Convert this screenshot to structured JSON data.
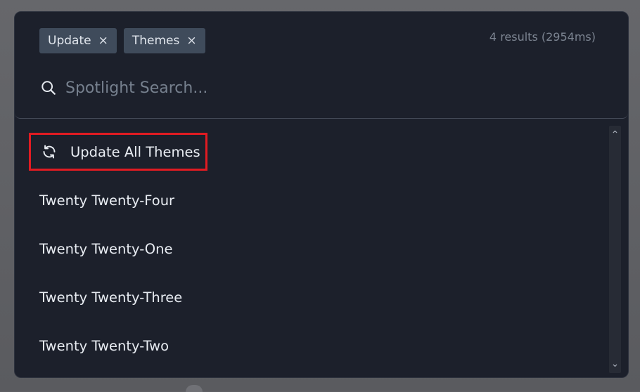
{
  "filters": [
    {
      "label": "Update"
    },
    {
      "label": "Themes"
    }
  ],
  "remove_glyph": "×",
  "results_count": "4 results (2954ms)",
  "search": {
    "placeholder": "Spotlight Search...",
    "icon": "search-icon"
  },
  "results": {
    "highlighted": {
      "label": "Update All Themes",
      "icon": "refresh-icon"
    },
    "items": [
      {
        "label": "Twenty Twenty-Four"
      },
      {
        "label": "Twenty Twenty-One"
      },
      {
        "label": "Twenty Twenty-Three"
      },
      {
        "label": "Twenty Twenty-Two"
      }
    ]
  },
  "scroll": {
    "up": "⌃",
    "down": "⌄"
  },
  "colors": {
    "panel": "#1c202b",
    "chip": "#3f4b5b",
    "highlight_border": "#e11b22",
    "text": "#e8ecf2",
    "muted": "#76808e"
  }
}
